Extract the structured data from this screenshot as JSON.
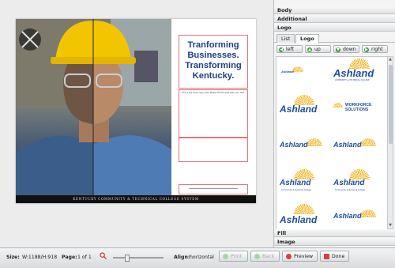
{
  "canvas": {
    "headline": "Tranforming Businesses. Transforming Kentucky.",
    "body_placeholder": "This is the body copy area. Please fill this area with your text",
    "footer_text": "KENTUCKY COMMUNITY & TECHNICAL COLLEGE SYSTEM"
  },
  "panel": {
    "sections": {
      "body": "Body",
      "additional": "Additional",
      "logo": "Logo",
      "fill": "Fill",
      "image": "Image"
    },
    "tabs": [
      "List",
      "Logo"
    ],
    "active_tab": "Logo",
    "nav_buttons": [
      "left",
      "up",
      "down",
      "right"
    ],
    "logos": [
      {
        "word": "Ashland",
        "sub": ""
      },
      {
        "word": "Ashland",
        "sub": "COMMUNITY & TECHNICAL COLLEGE"
      },
      {
        "word": "Ashland",
        "sub": ""
      },
      {
        "word": "WORKFORCE SOLUTIONS",
        "sub": ""
      },
      {
        "word": "Ashland",
        "sub": ""
      },
      {
        "word": "Ashland",
        "sub": ""
      },
      {
        "word": "Ashland",
        "sub": "Community & Technical College"
      },
      {
        "word": "Ashland",
        "sub": "Community & Technical College"
      },
      {
        "word": "Ashland",
        "sub": ""
      },
      {
        "word": "Ashland",
        "sub": ""
      }
    ]
  },
  "status": {
    "size_label": "Size:",
    "size_value": "W:1188/H:918",
    "page_label": "Page:",
    "page_value": "1 of 1",
    "align_label": "Align:",
    "align_value": "horizontal",
    "zoom_level": 0.3,
    "buttons": {
      "print": "Print",
      "back": "Back",
      "preview": "Preview",
      "done": "Done"
    }
  },
  "colors": {
    "accent_blue": "#1e4da0",
    "logo_gold": "#f2b31b",
    "guide_red": "#e1747c",
    "headline_blue": "#1d3f82"
  }
}
